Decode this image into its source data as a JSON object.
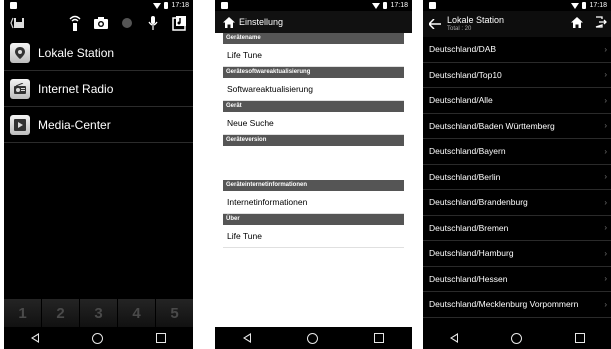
{
  "status": {
    "time": "17:18"
  },
  "screen1": {
    "stations": [
      {
        "label": "Lokale Station",
        "icon": "map-pin-icon"
      },
      {
        "label": "Internet Radio",
        "icon": "radio-icon"
      },
      {
        "label": "Media-Center",
        "icon": "play-icon"
      }
    ],
    "presets": [
      "1",
      "2",
      "3",
      "4",
      "5"
    ]
  },
  "screen2": {
    "title": "Einstellung",
    "sections": [
      {
        "header": "Gerätename",
        "rows": [
          "Life Tune"
        ]
      },
      {
        "header": "Gerätesoftwareaktualisierung",
        "rows": [
          "Softwareaktualisierung"
        ]
      },
      {
        "header": "Gerät",
        "rows": [
          "Neue Suche"
        ]
      },
      {
        "header": "Geräteversion",
        "rows": [
          ""
        ]
      },
      {
        "header": "Geräteinternetinformationen",
        "rows": [
          "Internetinformationen"
        ]
      },
      {
        "header": "Über",
        "rows": [
          "Life Tune"
        ]
      }
    ]
  },
  "screen3": {
    "title": "Lokale Station",
    "subtitle": "Total : 20",
    "items": [
      "Deutschland/DAB",
      "Deutschland/Top10",
      "Deutschland/Alle",
      "Deutschland/Baden Württemberg",
      "Deutschland/Bayern",
      "Deutschland/Berlin",
      "Deutschland/Brandenburg",
      "Deutschland/Bremen",
      "Deutschland/Hamburg",
      "Deutschland/Hessen",
      "Deutschland/Mecklenburg Vorpommern"
    ]
  }
}
